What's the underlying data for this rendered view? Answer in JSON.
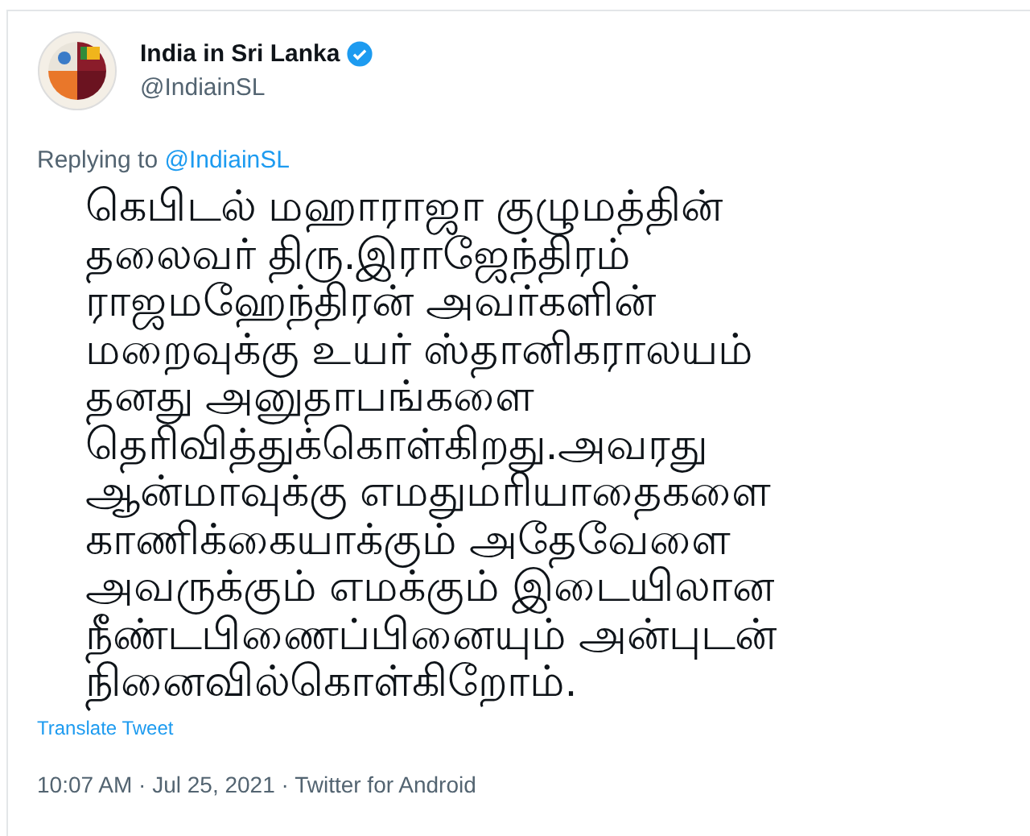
{
  "account": {
    "name": "India in Sri Lanka",
    "verified": true,
    "handle": "@IndiainSL"
  },
  "reply": {
    "prefix": "Replying to",
    "mention": "@IndiainSL"
  },
  "body_lines": [
    "கெபிடல் மஹாராஜா குழுமத்தின்",
    "தலைவர் திரு.இராஜேந்திரம்",
    "ராஜமஹேந்திரன் அவர்களின்",
    "மறைவுக்கு உயர் ஸ்தானிகராலயம்",
    "தனது அனுதாபங்களை",
    "தெரிவித்துக்கொள்கிறது.அவரது",
    "ஆன்மாவுக்கு எமதுமரியாதைகளை",
    "காணிக்கையாக்கும் அதேவேளை",
    "அவருக்கும் எமக்கும் இடையிலான",
    "நீண்டபிணைப்பினையும் அன்புடன்",
    "நினைவில்கொள்கிறோம்."
  ],
  "translate_link": "Translate Tweet",
  "meta": "10:07 AM · Jul 25, 2021 · Twitter for Android"
}
